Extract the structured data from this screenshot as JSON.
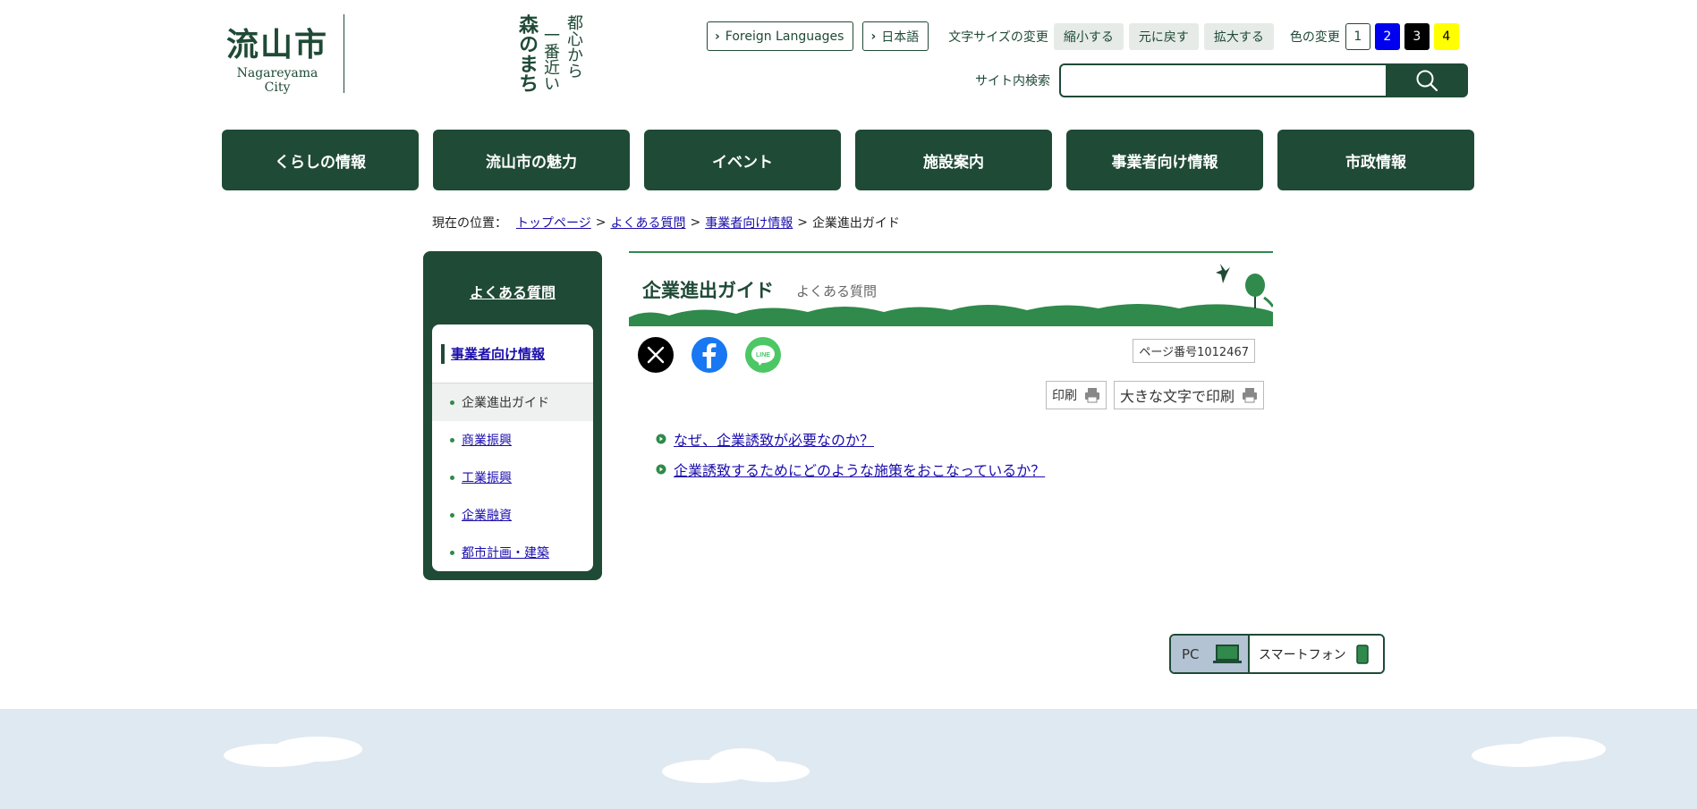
{
  "logo": {
    "city_kanji": "流山市",
    "city_roman": "Nagareyama City",
    "slogan_lines": [
      "都心から",
      "一番近い",
      "森のまち"
    ]
  },
  "header": {
    "foreign_languages": "Foreign Languages",
    "japanese": "日本語",
    "font_size_label": "文字サイズの変更",
    "font_size_buttons": [
      "縮小する",
      "元に戻す",
      "拡大する"
    ],
    "color_label": "色の変更",
    "color_buttons": [
      {
        "label": "1",
        "bg": "#ffffff",
        "fg": "#1f4a36",
        "border": "#1f4a36"
      },
      {
        "label": "2",
        "bg": "#0000ee",
        "fg": "#ffffff",
        "border": "#0000ee"
      },
      {
        "label": "3",
        "bg": "#000000",
        "fg": "#ffffff",
        "border": "#000000"
      },
      {
        "label": "4",
        "bg": "#ffff00",
        "fg": "#000000",
        "border": "#ffff00"
      }
    ],
    "search_label": "サイト内検索",
    "search_value": ""
  },
  "nav": {
    "items": [
      "くらしの情報",
      "流山市の魅力",
      "イベント",
      "施設案内",
      "事業者向け情報",
      "市政情報"
    ]
  },
  "breadcrumb": {
    "label": "現在の位置：",
    "links": [
      "トップページ",
      "よくある質問",
      "事業者向け情報"
    ],
    "current": "企業進出ガイド",
    "separator": ">"
  },
  "sidebar": {
    "title": "よくある質問",
    "section": "事業者向け情報",
    "items": [
      {
        "label": "企業進出ガイド",
        "current": true
      },
      {
        "label": "商業振興",
        "current": false
      },
      {
        "label": "工業振興",
        "current": false
      },
      {
        "label": "企業融資",
        "current": false
      },
      {
        "label": "都市計画・建築",
        "current": false
      }
    ]
  },
  "main": {
    "title": "企業進出ガイド",
    "category": "よくある質問",
    "page_number": "ページ番号1012467",
    "social": [
      "x-icon",
      "facebook-icon",
      "line-icon"
    ],
    "print": "印刷",
    "print_large": "大きな文字で印刷",
    "faq_links": [
      "なぜ、企業誘致が必要なのか？",
      "企業誘致するためにどのような施策をおこなっているか？"
    ]
  },
  "device_switch": {
    "pc": "PC",
    "smartphone": "スマートフォン"
  },
  "colors": {
    "brand": "#1f4a36",
    "accent_green": "#2f8a4b",
    "link": "#1a0dab",
    "footer_sky": "#dfe9f2"
  }
}
